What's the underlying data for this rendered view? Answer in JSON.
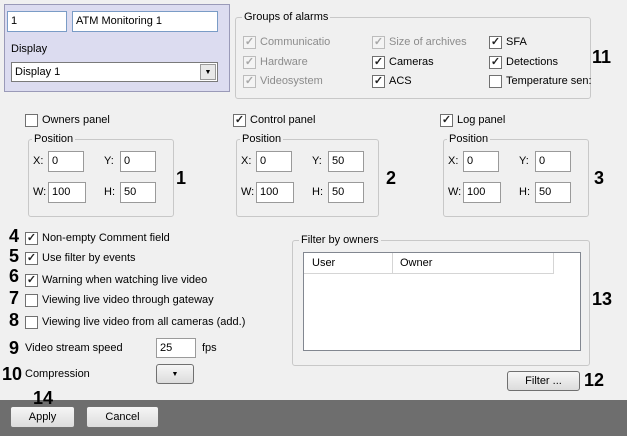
{
  "camera": {
    "id": "1",
    "name": "ATM Monitoring 1",
    "display_label": "Display",
    "display_value": "Display 1"
  },
  "alarm_groups": {
    "title": "Groups of alarms",
    "items": [
      {
        "label": "Communicatio",
        "checked": true,
        "enabled": false
      },
      {
        "label": "Size of archives",
        "checked": true,
        "enabled": false
      },
      {
        "label": "SFA",
        "checked": true,
        "enabled": true
      },
      {
        "label": "Hardware",
        "checked": true,
        "enabled": false
      },
      {
        "label": "Cameras",
        "checked": true,
        "enabled": true
      },
      {
        "label": "Detections",
        "checked": true,
        "enabled": true
      },
      {
        "label": "Videosystem",
        "checked": true,
        "enabled": false
      },
      {
        "label": "ACS",
        "checked": true,
        "enabled": true
      },
      {
        "label": "Temperature sen:",
        "checked": false,
        "enabled": true
      }
    ]
  },
  "panels": [
    {
      "label": "Owners panel",
      "checked": false,
      "position_label": "Position",
      "x_label": "X:",
      "x": "0",
      "y_label": "Y:",
      "y": "0",
      "w_label": "W:",
      "w": "100",
      "h_label": "H:",
      "h": "50"
    },
    {
      "label": "Control panel",
      "checked": true,
      "position_label": "Position",
      "x_label": "X:",
      "x": "0",
      "y_label": "Y:",
      "y": "50",
      "w_label": "W:",
      "w": "100",
      "h_label": "H:",
      "h": "50"
    },
    {
      "label": "Log panel",
      "checked": true,
      "position_label": "Position",
      "x_label": "X:",
      "x": "0",
      "y_label": "Y:",
      "y": "0",
      "w_label": "W:",
      "w": "100",
      "h_label": "H:",
      "h": "50"
    }
  ],
  "options": [
    {
      "label": "Non-empty Comment field",
      "checked": true
    },
    {
      "label": "Use filter by events",
      "checked": true
    },
    {
      "label": "Warning when watching live video",
      "checked": true
    },
    {
      "label": "Viewing live video through gateway",
      "checked": false
    },
    {
      "label": "Viewing live video from all cameras (add.)",
      "checked": false
    }
  ],
  "video_speed": {
    "label": "Video stream speed",
    "value": "25",
    "unit": "fps"
  },
  "compression": {
    "label": "Compression",
    "value": ""
  },
  "filter_owners": {
    "title": "Filter by owners",
    "columns": [
      "User",
      "Owner"
    ],
    "filter_button": "Filter ..."
  },
  "footer": {
    "apply": "Apply",
    "cancel": "Cancel"
  },
  "callouts": [
    "1",
    "2",
    "3",
    "4",
    "5",
    "6",
    "7",
    "8",
    "9",
    "10",
    "11",
    "12",
    "13",
    "14"
  ],
  "colors": {
    "panel_bg": "#f0f0f0",
    "top_box_bg": "#dcdcf0",
    "footer_bg": "#6e6e6e",
    "field_border": "#7a9cc6"
  }
}
